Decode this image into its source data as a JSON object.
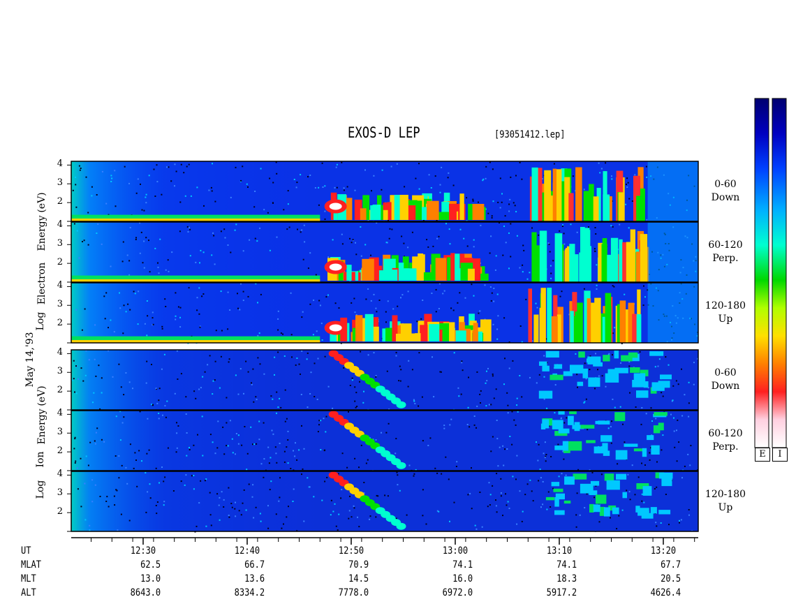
{
  "header": {
    "title": "EXOS-D LEP",
    "file": "[93051412.lep]"
  },
  "date_label": "May 14,'93",
  "electron_axis_label": [
    "Log",
    "Electron",
    "Energy",
    "(eV)"
  ],
  "ion_axis_label": [
    "Log",
    "Ion",
    "Energy",
    "(eV)"
  ],
  "panels": [
    {
      "species": "electron",
      "pitch": "0-60",
      "dir": "Down",
      "yticks": [
        "4",
        "3",
        "2"
      ]
    },
    {
      "species": "electron",
      "pitch": "60-120",
      "dir": "Perp.",
      "yticks": [
        "4",
        "3",
        "2"
      ]
    },
    {
      "species": "electron",
      "pitch": "120-180",
      "dir": "Up",
      "yticks": [
        "4",
        "3",
        "2"
      ]
    },
    {
      "species": "ion",
      "pitch": "0-60",
      "dir": "Down",
      "yticks": [
        "4",
        "3",
        "2"
      ]
    },
    {
      "species": "ion",
      "pitch": "60-120",
      "dir": "Perp.",
      "yticks": [
        "4",
        "3",
        "2"
      ]
    },
    {
      "species": "ion",
      "pitch": "120-180",
      "dir": "Up",
      "yticks": [
        "4",
        "3",
        "2"
      ]
    }
  ],
  "colorbar": {
    "labels": [
      "E",
      "I"
    ],
    "colors": [
      "#ffffff",
      "#ffd0e0",
      "#ff3030",
      "#ff8000",
      "#ffd000",
      "#c0ff00",
      "#00d800",
      "#00ffd0",
      "#00b0ff",
      "#0040ff",
      "#0000c0",
      "#000070"
    ]
  },
  "row_labels": [
    "UT",
    "MLAT",
    "MLT",
    "ALT"
  ],
  "chart_data": {
    "type": "heatmap",
    "title": "EXOS-D LEP",
    "subtitle": "[93051412.lep]",
    "xlabel": "UT",
    "ylabel_electron": "Log Electron Energy (eV)",
    "ylabel_ion": "Log Ion Energy (eV)",
    "ylim": [
      1,
      4.2
    ],
    "x_ticks": [
      "12:30",
      "12:40",
      "12:50",
      "13:00",
      "13:10",
      "13:20"
    ],
    "ephemeris": {
      "MLAT": [
        "62.5",
        "66.7",
        "70.9",
        "74.1",
        "74.1",
        "67.7"
      ],
      "MLT": [
        "13.0",
        "13.6",
        "14.5",
        "16.0",
        "18.3",
        "20.5"
      ],
      "ALT": [
        "8643.0",
        "8334.2",
        "7778.0",
        "6972.0",
        "5917.2",
        "4626.4"
      ]
    },
    "series": [
      {
        "name": "0-60 Down"
      },
      {
        "name": "60-120 Perp."
      },
      {
        "name": "120-180 Up"
      }
    ]
  }
}
